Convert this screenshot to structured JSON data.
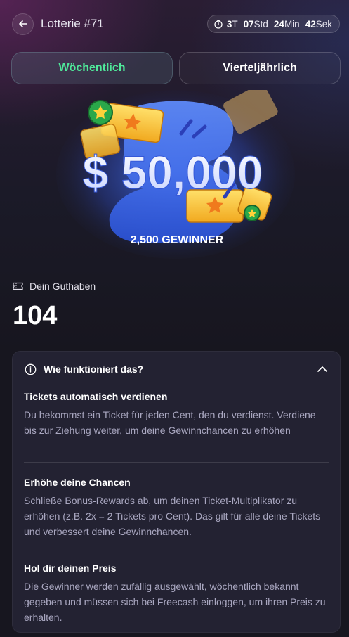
{
  "header": {
    "title": "Lotterie #71",
    "timer": {
      "days": "3",
      "days_unit": "T",
      "hours": "07",
      "hours_unit": "Std",
      "minutes": "24",
      "minutes_unit": "Min",
      "seconds": "42",
      "seconds_unit": "Sek"
    }
  },
  "tabs": [
    {
      "label": "Wöchentlich",
      "active": true
    },
    {
      "label": "Vierteljährlich",
      "active": false
    }
  ],
  "hero": {
    "prize": "$ 50,000",
    "winners": "2,500 GEWINNER"
  },
  "balance": {
    "label": "Dein Guthaben",
    "value": "104"
  },
  "faq": {
    "title": "Wie funktioniert das?",
    "sections": [
      {
        "heading": "Tickets automatisch verdienen",
        "text": "Du bekommst ein Ticket für jeden Cent, den du verdienst. Verdiene bis zur Ziehung weiter, um deine Gewinnchancen zu erhöhen"
      },
      {
        "heading": "Erhöhe deine Chancen",
        "text": "Schließe Bonus-Rewards ab, um deinen Ticket-Multiplikator zu erhöhen (z.B. 2x = 2 Tickets pro Cent). Das gilt für alle deine Tickets und verbessert deine Gewinnchancen."
      },
      {
        "heading": "Hol dir deinen Preis",
        "text": "Die Gewinner werden zufällig ausgewählt, wöchentlich bekannt gegeben und müssen sich bei Freecash einloggen, um ihren Preis zu erhalten."
      }
    ]
  },
  "colors": {
    "accent_green": "#4fe89a",
    "background": "#17161f",
    "panel": "#232232",
    "body_text": "#a9a7c0",
    "ticket_gold": "#f5c232",
    "hero_blue": "#3f6ff0"
  },
  "icons": {
    "back": "arrow-left-icon",
    "timer": "stopwatch-icon",
    "balance": "ticket-icon",
    "faq": "info-icon",
    "toggle": "chevron-up-icon"
  }
}
